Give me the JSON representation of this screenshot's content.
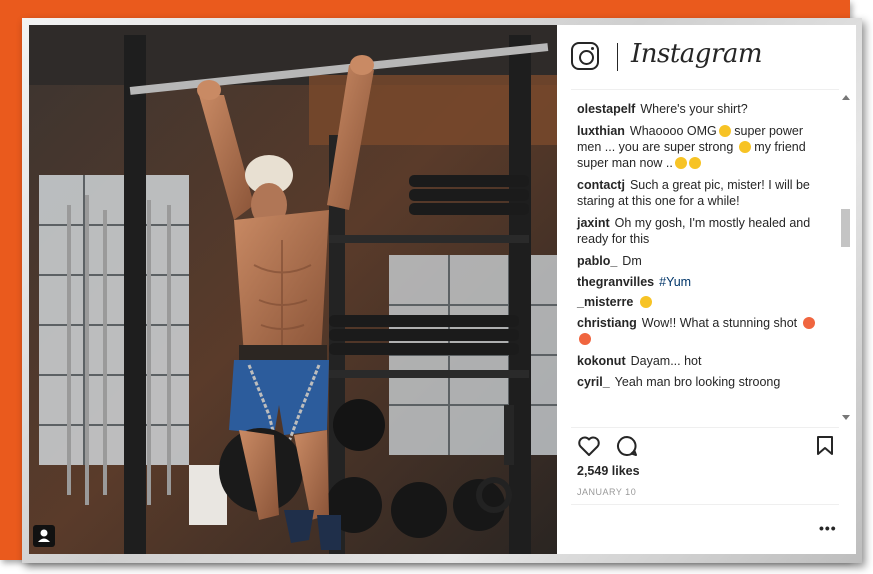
{
  "app": {
    "wordmark": "Instagram"
  },
  "comments": [
    {
      "user": "olestapelf",
      "text": "Where's your shirt?"
    },
    {
      "user": "luxthian",
      "text": "Whaoooo OMG",
      "text2": " super power men ... you are super strong ",
      "text3": " my friend super man now .."
    },
    {
      "user": "contactj",
      "text": "Such a great pic, mister! I will be staring at this one for a while!"
    },
    {
      "user": "jaxint",
      "text": "Oh my gosh, I'm mostly healed and ready for this"
    },
    {
      "user": "pablo_",
      "text": "Dm"
    },
    {
      "user": "thegranvilles",
      "hashtag": "#Yum"
    },
    {
      "user": "_misterre",
      "text": ""
    },
    {
      "user": "christiang",
      "text": "Wow!! What a stunning shot"
    },
    {
      "user": "kokonut",
      "text": "Dayam... hot"
    },
    {
      "user": "cyril_",
      "text": "Yeah man bro looking stroong"
    }
  ],
  "post": {
    "likes": "2,549 likes",
    "date": "JANUARY 10",
    "more_label": "•••"
  },
  "icons": {
    "logo": "instagram-camera-icon",
    "like": "heart-icon",
    "comment": "comment-bubble-icon",
    "save": "bookmark-icon",
    "badge": "user-tag-icon",
    "more": "more-options-icon"
  },
  "colors": {
    "frame_orange": "#ea5a1d",
    "text": "#262626",
    "date": "#999999"
  }
}
